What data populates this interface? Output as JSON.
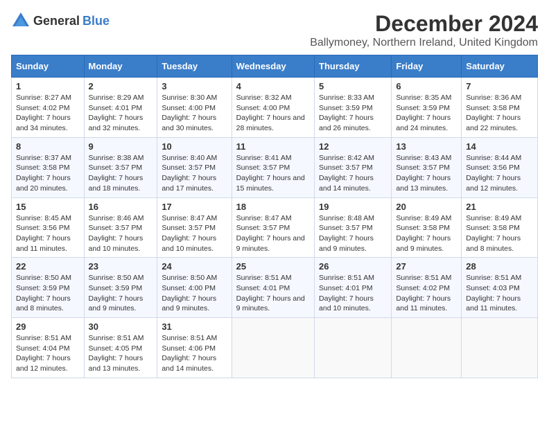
{
  "logo": {
    "general": "General",
    "blue": "Blue"
  },
  "title": "December 2024",
  "subtitle": "Ballymoney, Northern Ireland, United Kingdom",
  "weekdays": [
    "Sunday",
    "Monday",
    "Tuesday",
    "Wednesday",
    "Thursday",
    "Friday",
    "Saturday"
  ],
  "weeks": [
    [
      {
        "day": "1",
        "sunrise": "Sunrise: 8:27 AM",
        "sunset": "Sunset: 4:02 PM",
        "daylight": "Daylight: 7 hours and 34 minutes."
      },
      {
        "day": "2",
        "sunrise": "Sunrise: 8:29 AM",
        "sunset": "Sunset: 4:01 PM",
        "daylight": "Daylight: 7 hours and 32 minutes."
      },
      {
        "day": "3",
        "sunrise": "Sunrise: 8:30 AM",
        "sunset": "Sunset: 4:00 PM",
        "daylight": "Daylight: 7 hours and 30 minutes."
      },
      {
        "day": "4",
        "sunrise": "Sunrise: 8:32 AM",
        "sunset": "Sunset: 4:00 PM",
        "daylight": "Daylight: 7 hours and 28 minutes."
      },
      {
        "day": "5",
        "sunrise": "Sunrise: 8:33 AM",
        "sunset": "Sunset: 3:59 PM",
        "daylight": "Daylight: 7 hours and 26 minutes."
      },
      {
        "day": "6",
        "sunrise": "Sunrise: 8:35 AM",
        "sunset": "Sunset: 3:59 PM",
        "daylight": "Daylight: 7 hours and 24 minutes."
      },
      {
        "day": "7",
        "sunrise": "Sunrise: 8:36 AM",
        "sunset": "Sunset: 3:58 PM",
        "daylight": "Daylight: 7 hours and 22 minutes."
      }
    ],
    [
      {
        "day": "8",
        "sunrise": "Sunrise: 8:37 AM",
        "sunset": "Sunset: 3:58 PM",
        "daylight": "Daylight: 7 hours and 20 minutes."
      },
      {
        "day": "9",
        "sunrise": "Sunrise: 8:38 AM",
        "sunset": "Sunset: 3:57 PM",
        "daylight": "Daylight: 7 hours and 18 minutes."
      },
      {
        "day": "10",
        "sunrise": "Sunrise: 8:40 AM",
        "sunset": "Sunset: 3:57 PM",
        "daylight": "Daylight: 7 hours and 17 minutes."
      },
      {
        "day": "11",
        "sunrise": "Sunrise: 8:41 AM",
        "sunset": "Sunset: 3:57 PM",
        "daylight": "Daylight: 7 hours and 15 minutes."
      },
      {
        "day": "12",
        "sunrise": "Sunrise: 8:42 AM",
        "sunset": "Sunset: 3:57 PM",
        "daylight": "Daylight: 7 hours and 14 minutes."
      },
      {
        "day": "13",
        "sunrise": "Sunrise: 8:43 AM",
        "sunset": "Sunset: 3:57 PM",
        "daylight": "Daylight: 7 hours and 13 minutes."
      },
      {
        "day": "14",
        "sunrise": "Sunrise: 8:44 AM",
        "sunset": "Sunset: 3:56 PM",
        "daylight": "Daylight: 7 hours and 12 minutes."
      }
    ],
    [
      {
        "day": "15",
        "sunrise": "Sunrise: 8:45 AM",
        "sunset": "Sunset: 3:56 PM",
        "daylight": "Daylight: 7 hours and 11 minutes."
      },
      {
        "day": "16",
        "sunrise": "Sunrise: 8:46 AM",
        "sunset": "Sunset: 3:57 PM",
        "daylight": "Daylight: 7 hours and 10 minutes."
      },
      {
        "day": "17",
        "sunrise": "Sunrise: 8:47 AM",
        "sunset": "Sunset: 3:57 PM",
        "daylight": "Daylight: 7 hours and 10 minutes."
      },
      {
        "day": "18",
        "sunrise": "Sunrise: 8:47 AM",
        "sunset": "Sunset: 3:57 PM",
        "daylight": "Daylight: 7 hours and 9 minutes."
      },
      {
        "day": "19",
        "sunrise": "Sunrise: 8:48 AM",
        "sunset": "Sunset: 3:57 PM",
        "daylight": "Daylight: 7 hours and 9 minutes."
      },
      {
        "day": "20",
        "sunrise": "Sunrise: 8:49 AM",
        "sunset": "Sunset: 3:58 PM",
        "daylight": "Daylight: 7 hours and 9 minutes."
      },
      {
        "day": "21",
        "sunrise": "Sunrise: 8:49 AM",
        "sunset": "Sunset: 3:58 PM",
        "daylight": "Daylight: 7 hours and 8 minutes."
      }
    ],
    [
      {
        "day": "22",
        "sunrise": "Sunrise: 8:50 AM",
        "sunset": "Sunset: 3:59 PM",
        "daylight": "Daylight: 7 hours and 8 minutes."
      },
      {
        "day": "23",
        "sunrise": "Sunrise: 8:50 AM",
        "sunset": "Sunset: 3:59 PM",
        "daylight": "Daylight: 7 hours and 9 minutes."
      },
      {
        "day": "24",
        "sunrise": "Sunrise: 8:50 AM",
        "sunset": "Sunset: 4:00 PM",
        "daylight": "Daylight: 7 hours and 9 minutes."
      },
      {
        "day": "25",
        "sunrise": "Sunrise: 8:51 AM",
        "sunset": "Sunset: 4:01 PM",
        "daylight": "Daylight: 7 hours and 9 minutes."
      },
      {
        "day": "26",
        "sunrise": "Sunrise: 8:51 AM",
        "sunset": "Sunset: 4:01 PM",
        "daylight": "Daylight: 7 hours and 10 minutes."
      },
      {
        "day": "27",
        "sunrise": "Sunrise: 8:51 AM",
        "sunset": "Sunset: 4:02 PM",
        "daylight": "Daylight: 7 hours and 11 minutes."
      },
      {
        "day": "28",
        "sunrise": "Sunrise: 8:51 AM",
        "sunset": "Sunset: 4:03 PM",
        "daylight": "Daylight: 7 hours and 11 minutes."
      }
    ],
    [
      {
        "day": "29",
        "sunrise": "Sunrise: 8:51 AM",
        "sunset": "Sunset: 4:04 PM",
        "daylight": "Daylight: 7 hours and 12 minutes."
      },
      {
        "day": "30",
        "sunrise": "Sunrise: 8:51 AM",
        "sunset": "Sunset: 4:05 PM",
        "daylight": "Daylight: 7 hours and 13 minutes."
      },
      {
        "day": "31",
        "sunrise": "Sunrise: 8:51 AM",
        "sunset": "Sunset: 4:06 PM",
        "daylight": "Daylight: 7 hours and 14 minutes."
      },
      null,
      null,
      null,
      null
    ]
  ]
}
